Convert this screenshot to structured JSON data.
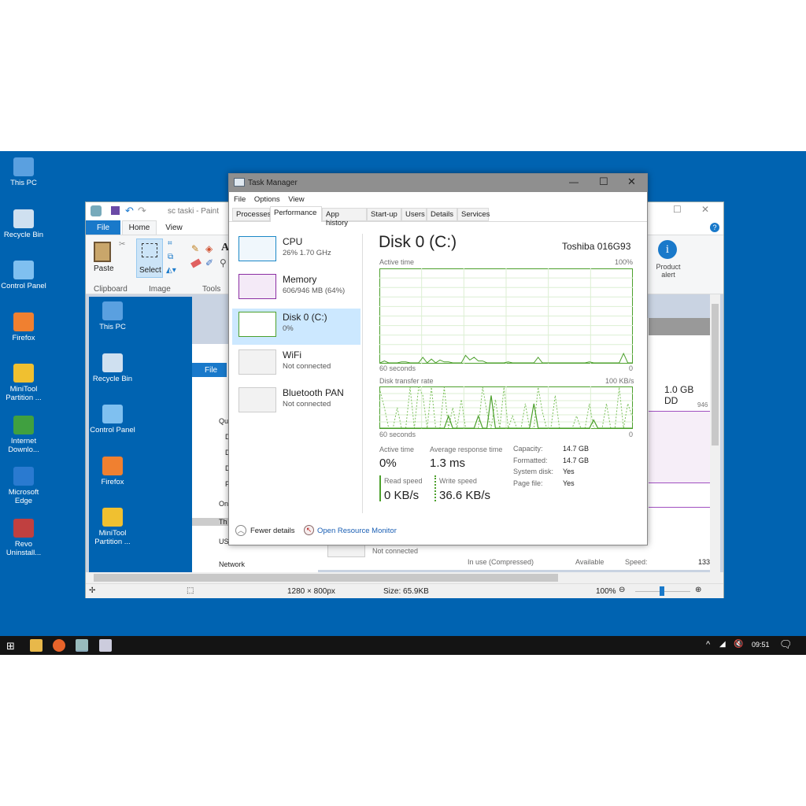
{
  "desktop": {
    "icons": [
      {
        "label": "This PC"
      },
      {
        "label": "Recycle Bin"
      },
      {
        "label": "Control Panel"
      },
      {
        "label": "Firefox"
      },
      {
        "label": "MiniTool Partition ..."
      },
      {
        "label": "Internet Downlo..."
      },
      {
        "label": "Microsoft Edge"
      },
      {
        "label": "Revo Uninstall..."
      }
    ]
  },
  "paint": {
    "title": "sc taski - Paint",
    "tabs": [
      "File",
      "Home",
      "View"
    ],
    "paste": "Paste",
    "select": "Select",
    "groups": [
      "Clipboard",
      "Image",
      "Tools"
    ],
    "product_alert": "Product alert",
    "status": {
      "dimensions": "1280 × 800px",
      "size": "Size: 65.9KB",
      "zoom": "100%"
    },
    "canvas": {
      "icons": [
        "This PC",
        "Recycle Bin",
        "Control Panel",
        "Firefox",
        "MiniTool Partition ..."
      ],
      "explorer_file": "File",
      "explorer_items": [
        "Qu",
        "D",
        "D",
        "D",
        "P",
        "On",
        "Th",
        "US",
        "Network"
      ],
      "not_connected": "Not connected",
      "gb": "1.0 GB DD",
      "mem_max": "946",
      "in_use": "In use (Compressed)",
      "available": "Available",
      "speed": "Speed:",
      "speed_val": "133"
    }
  },
  "taskmanager": {
    "title": "Task Manager",
    "menu": [
      "File",
      "Options",
      "View"
    ],
    "tabs": [
      "Processes",
      "Performance",
      "App history",
      "Start-up",
      "Users",
      "Details",
      "Services"
    ],
    "sidebar": [
      {
        "name": "CPU",
        "sub": "26%  1.70 GHz"
      },
      {
        "name": "Memory",
        "sub": "606/946 MB (64%)"
      },
      {
        "name": "Disk 0 (C:)",
        "sub": "0%"
      },
      {
        "name": "WiFi",
        "sub": "Not connected"
      },
      {
        "name": "Bluetooth PAN",
        "sub": "Not connected"
      }
    ],
    "disk": {
      "title": "Disk 0 (C:)",
      "model": "Toshiba 016G93",
      "active_label": "Active time",
      "active_max": "100%",
      "seconds": "60 seconds",
      "zero": "0",
      "transfer_label": "Disk transfer rate",
      "transfer_max": "100 KB/s",
      "stats": {
        "active_time_label": "Active time",
        "active_time": "0%",
        "resp_label": "Average response time",
        "resp": "1.3 ms",
        "read_label": "Read speed",
        "read": "0 KB/s",
        "write_label": "Write speed",
        "write": "36.6 KB/s"
      },
      "props": [
        {
          "k": "Capacity:",
          "v": "14.7 GB"
        },
        {
          "k": "Formatted:",
          "v": "14.7 GB"
        },
        {
          "k": "System disk:",
          "v": "Yes"
        },
        {
          "k": "Page file:",
          "v": "Yes"
        }
      ]
    },
    "fewer": "Fewer details",
    "resmon": "Open Resource Monitor",
    "chart_data": {
      "type": "line",
      "active_time": [
        0,
        2,
        0,
        0,
        0,
        1,
        1,
        0,
        0,
        0,
        6,
        0,
        4,
        0,
        3,
        1,
        1,
        0,
        0,
        0,
        8,
        3,
        6,
        2,
        2,
        0,
        0,
        0,
        0,
        0,
        1,
        0,
        0,
        0,
        0,
        0,
        0,
        6,
        0,
        0,
        0,
        0,
        0,
        0,
        0,
        0,
        0,
        0,
        0,
        1,
        0,
        0,
        0,
        0,
        0,
        0,
        0,
        10,
        0,
        0
      ],
      "write_rate": [
        90,
        50,
        0,
        0,
        50,
        0,
        0,
        100,
        0,
        100,
        80,
        0,
        100,
        0,
        0,
        100,
        0,
        50,
        0,
        70,
        0,
        0,
        0,
        0,
        100,
        40,
        0,
        70,
        0,
        100,
        0,
        30,
        0,
        0,
        60,
        0,
        0,
        100,
        40,
        0,
        0,
        80,
        0,
        0,
        0,
        0,
        30,
        0,
        0,
        60,
        0,
        0,
        0,
        60,
        0,
        0,
        100,
        0,
        60,
        30
      ],
      "read_rate": [
        0,
        0,
        0,
        0,
        0,
        0,
        0,
        0,
        0,
        0,
        0,
        0,
        0,
        0,
        0,
        0,
        30,
        0,
        0,
        0,
        0,
        0,
        0,
        30,
        0,
        0,
        80,
        0,
        0,
        0,
        0,
        0,
        0,
        0,
        0,
        0,
        60,
        0,
        0,
        0,
        0,
        0,
        0,
        0,
        0,
        0,
        0,
        0,
        0,
        0,
        20,
        0,
        0,
        0,
        0,
        0,
        0,
        0,
        0,
        0
      ]
    }
  },
  "taskbar": {
    "time": "09:51"
  }
}
